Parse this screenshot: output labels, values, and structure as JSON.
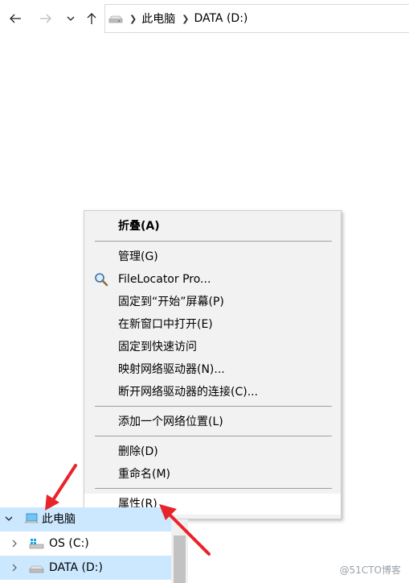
{
  "address": {
    "segments": [
      "此电脑",
      "DATA (D:)"
    ]
  },
  "context_menu": {
    "items": [
      {
        "label": "折叠(A)",
        "bold": true
      },
      {
        "label": "管理(G)"
      },
      {
        "label": "FileLocator Pro...",
        "icon": "magnifier-icon"
      },
      {
        "label": "固定到“开始”屏幕(P)"
      },
      {
        "label": "在新窗口中打开(E)"
      },
      {
        "label": "固定到快速访问"
      },
      {
        "label": "映射网络驱动器(N)..."
      },
      {
        "label": "断开网络驱动器的连接(C)..."
      },
      {
        "label": "添加一个网络位置(L)"
      },
      {
        "label": "删除(D)"
      },
      {
        "label": "重命名(M)"
      },
      {
        "label": "属性(R)",
        "highlighted": true
      }
    ]
  },
  "nav_tree": {
    "items": [
      {
        "label": "此电脑",
        "icon": "computer-icon",
        "expanded": true
      },
      {
        "label": "OS (C:)",
        "icon": "windows-drive-icon"
      },
      {
        "label": "DATA (D:)",
        "icon": "drive-icon",
        "selected": true
      }
    ]
  },
  "watermark": "@51CTO博客",
  "colors": {
    "selection": "#cce8ff",
    "menu_bg": "#f2f2f2",
    "arrow": "#e8242a"
  }
}
